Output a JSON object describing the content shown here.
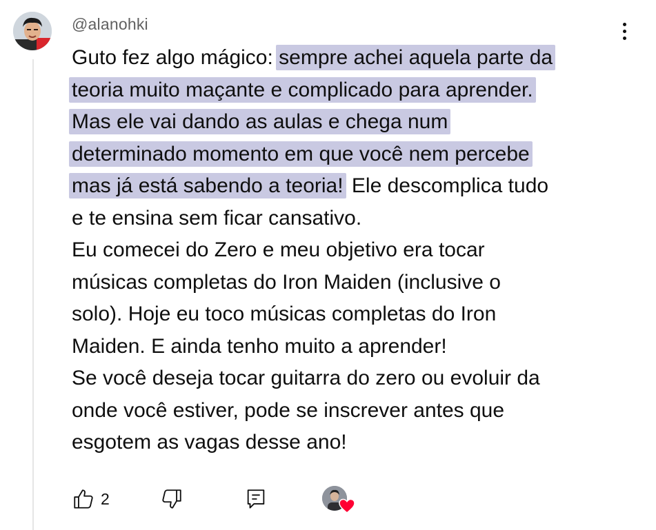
{
  "comment": {
    "author": "@alanohki",
    "lines": [
      [
        {
          "text": "Guto fez algo mágico: ",
          "highlight": false
        },
        {
          "text": "sempre achei aquela parte da",
          "highlight": true
        }
      ],
      [
        {
          "text": "teoria muito maçante e complicado para aprender.",
          "highlight": true
        }
      ],
      [
        {
          "text": "Mas ele vai dando as aulas e chega num",
          "highlight": true
        }
      ],
      [
        {
          "text": "determinado momento em que você nem percebe",
          "highlight": true
        }
      ],
      [
        {
          "text": "mas já está sabendo a teoria!",
          "highlight": true
        },
        {
          "text": " Ele descomplica tudo",
          "highlight": false
        }
      ],
      [
        {
          "text": "e te ensina sem ficar cansativo.",
          "highlight": false
        }
      ],
      [
        {
          "text": "Eu comecei do Zero e meu objetivo era tocar",
          "highlight": false
        }
      ],
      [
        {
          "text": "músicas completas do Iron Maiden (inclusive o",
          "highlight": false
        }
      ],
      [
        {
          "text": "solo). Hoje eu toco músicas completas do Iron",
          "highlight": false
        }
      ],
      [
        {
          "text": "Maiden. E ainda tenho muito a aprender!",
          "highlight": false
        }
      ],
      [
        {
          "text": "Se você deseja tocar guitarra do zero ou evoluir da",
          "highlight": false
        }
      ],
      [
        {
          "text": "onde você estiver, pode se inscrever antes que",
          "highlight": false
        }
      ],
      [
        {
          "text": "esgotem as vagas desse ano!",
          "highlight": false
        }
      ]
    ],
    "like_count": "2"
  },
  "icons": {
    "like": "thumbs-up-icon",
    "dislike": "thumbs-down-icon",
    "reply": "reply-comment-icon",
    "more": "more-vertical-icon",
    "creator_heart": "heart-icon"
  },
  "colors": {
    "highlight": "#c9c9e2",
    "heart": "#ff0033",
    "username": "#606060",
    "text": "#0f0f0f"
  }
}
